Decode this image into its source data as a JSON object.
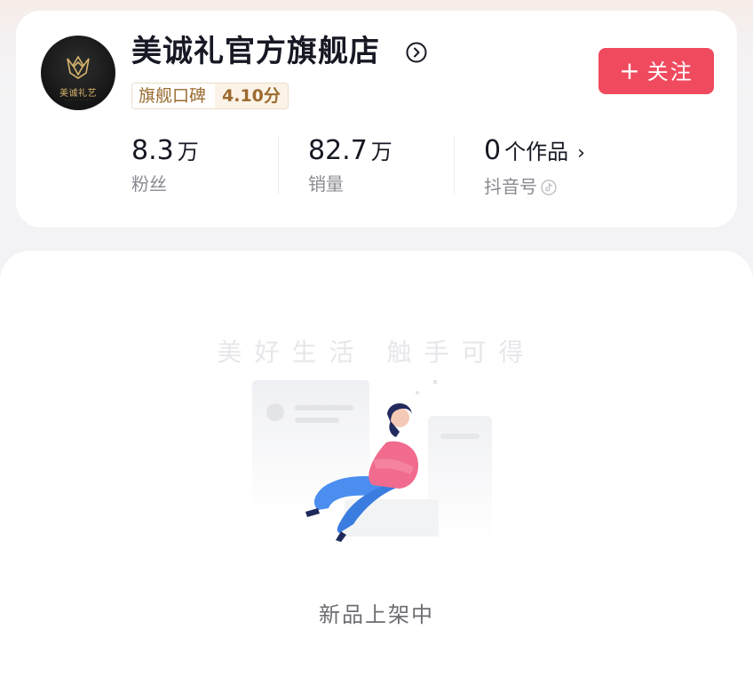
{
  "store": {
    "name": "美诚礼官方旗舰店",
    "avatar_text": "美诚礼艺",
    "rating_label": "旗舰口碑",
    "rating_score": "4.10分",
    "follow_label": "关注",
    "follow_plus": "+"
  },
  "stats": {
    "fans": {
      "value": "8.3",
      "unit": "万",
      "label": "粉丝"
    },
    "sales": {
      "value": "82.7",
      "unit": "万",
      "label": "销量"
    },
    "works": {
      "value": "0",
      "unit": "个作品",
      "arrow": "›",
      "label": "抖音号"
    }
  },
  "empty_state": {
    "slogan": "美好生活 触手可得",
    "message": "新品上架中"
  },
  "colors": {
    "accent": "#f04a5f",
    "rating_text": "#9b6a2f",
    "rating_bg": "#fbf3e7"
  },
  "icons": [
    "chevron-right-circle-icon",
    "plus-icon",
    "chevron-right-icon",
    "douyin-icon",
    "store-logo-icon"
  ]
}
